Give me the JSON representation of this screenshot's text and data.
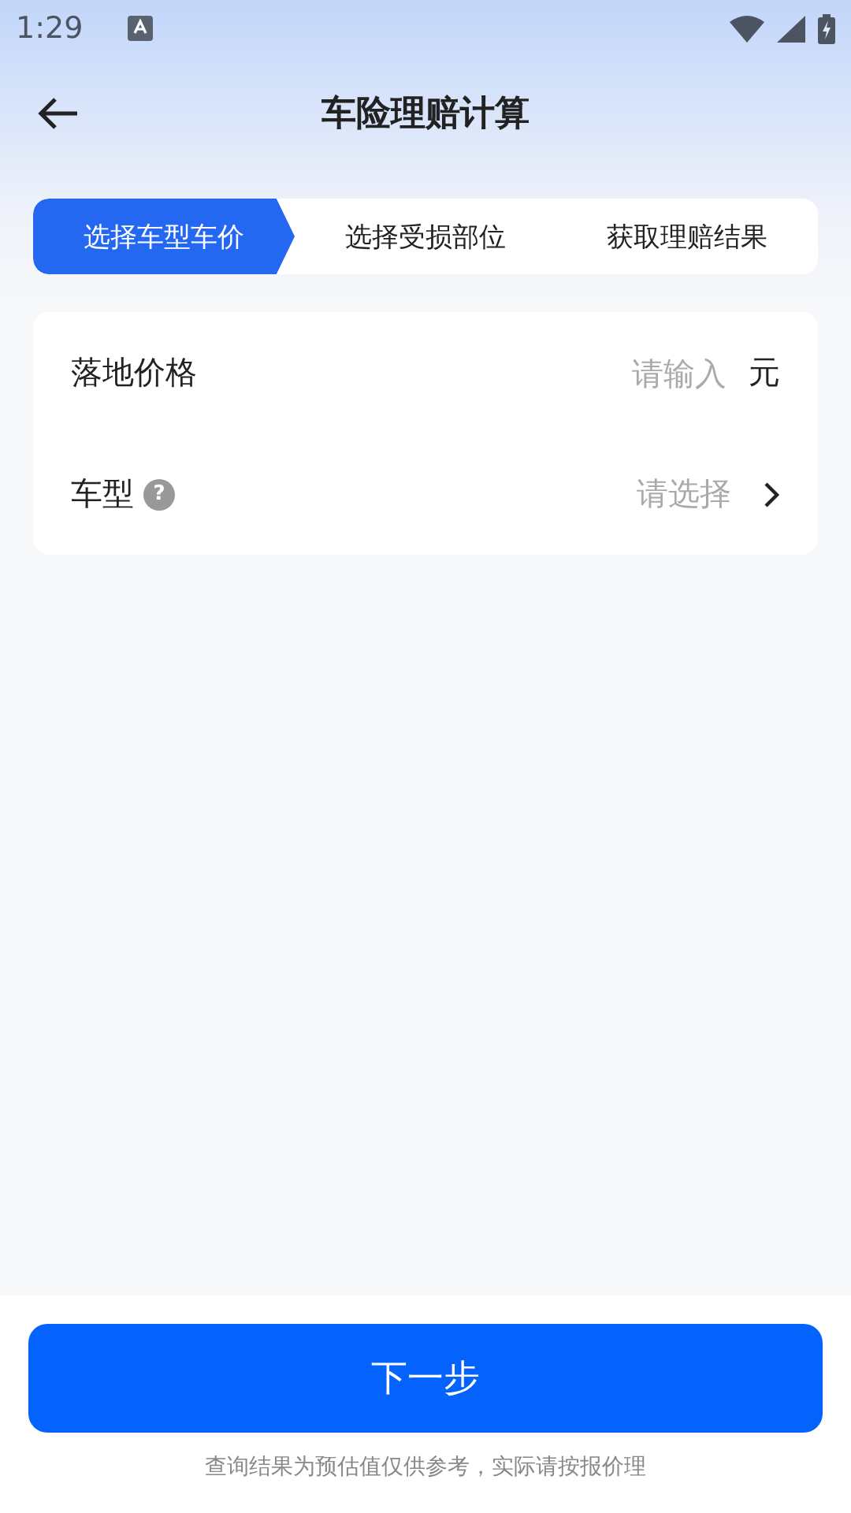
{
  "status_bar": {
    "time": "1:29"
  },
  "header": {
    "title": "车险理赔计算"
  },
  "steps": [
    {
      "label": "选择车型车价",
      "selected": true
    },
    {
      "label": "选择受损部位",
      "selected": false
    },
    {
      "label": "获取理赔结果",
      "selected": false
    }
  ],
  "form": [
    {
      "kind": "input",
      "label": "落地价格",
      "placeholder": "请输入",
      "unit": "元"
    },
    {
      "kind": "select",
      "label": "车型",
      "help": "?",
      "placeholder": "请选择"
    }
  ],
  "next_button": "下一步",
  "disclaimer": "查询结果为预估值仅供参考，实际请按报价理"
}
